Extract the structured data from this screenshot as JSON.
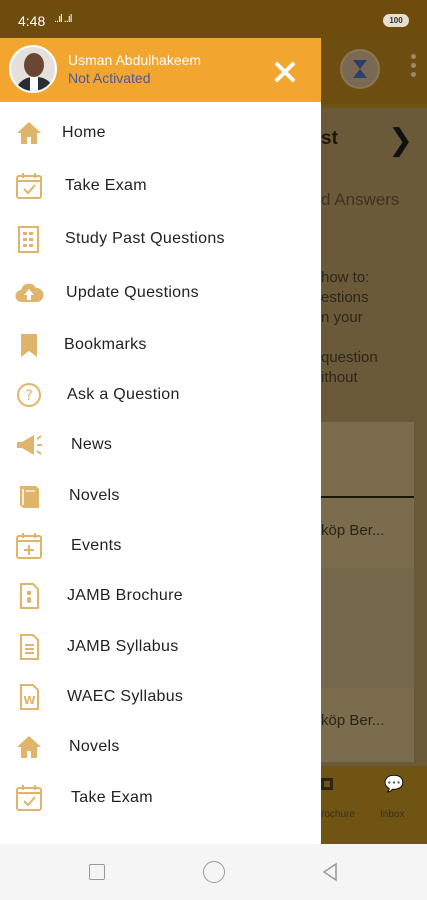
{
  "status_bar": {
    "time": "4:48",
    "signal": "..ıl ..ıl",
    "battery": "100"
  },
  "drawer": {
    "user_name": "Usman Abdulhakeem",
    "user_status": "Not Activated",
    "items": [
      {
        "label": "Home",
        "icon": "home-icon"
      },
      {
        "label": "Take Exam",
        "icon": "calendar-check-icon"
      },
      {
        "label": "Study Past Questions",
        "icon": "document-grid-icon"
      },
      {
        "label": "Update Questions",
        "icon": "cloud-upload-icon"
      },
      {
        "label": "Bookmarks",
        "icon": "bookmark-icon"
      },
      {
        "label": "Ask a Question",
        "icon": "question-circle-icon"
      },
      {
        "label": "News",
        "icon": "megaphone-icon"
      },
      {
        "label": "Novels",
        "icon": "book-icon"
      },
      {
        "label": "Events",
        "icon": "calendar-plus-icon"
      },
      {
        "label": "JAMB Brochure",
        "icon": "brochure-file-icon"
      },
      {
        "label": "JAMB Syllabus",
        "icon": "text-file-icon"
      },
      {
        "label": "WAEC Syllabus",
        "icon": "word-file-icon"
      },
      {
        "label": "Novels",
        "icon": "home-icon"
      },
      {
        "label": "Take Exam",
        "icon": "calendar-check-icon"
      }
    ]
  },
  "background": {
    "title": "st",
    "subtitle": "d Answers",
    "paragraph": "how to:\nestions\nn your\n\nquestion\nithout",
    "item1": "köp Ber...",
    "item2": "köp Ber...",
    "nav_label1": "rochure",
    "nav_label2": "Inbox"
  },
  "colors": {
    "accent": "#f2a52f",
    "icon": "#e0b46a",
    "status_link": "#4a5a9a"
  }
}
